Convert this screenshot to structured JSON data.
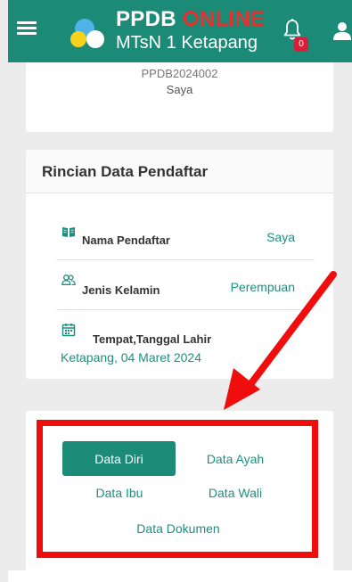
{
  "header": {
    "brand_main": "PPDB",
    "brand_accent": "ONLINE",
    "brand_sub": "MTsN 1 Ketapang",
    "notification_count": "0"
  },
  "summary": {
    "registration_number": "PPDB2024002",
    "name": "Saya"
  },
  "details": {
    "title": "Rincian Data Pendaftar",
    "rows": [
      {
        "label": "Nama Pendaftar",
        "value": "Saya",
        "icon": "book-icon"
      },
      {
        "label": "Jenis Kelamin",
        "value": "Perempuan",
        "icon": "users-icon"
      },
      {
        "label": "Tempat,Tanggal Lahir",
        "value": "Ketapang, 04 Maret 2024",
        "icon": "calendar-icon"
      }
    ]
  },
  "tabs": {
    "data_diri": "Data Diri",
    "data_ayah": "Data Ayah",
    "data_ibu": "Data Ibu",
    "data_wali": "Data Wali",
    "data_dokumen": "Data Dokumen"
  },
  "colors": {
    "primary": "#1b8a77",
    "accent_text": "#1b9080",
    "highlight": "#f00d0d",
    "badge": "#d6203a"
  }
}
